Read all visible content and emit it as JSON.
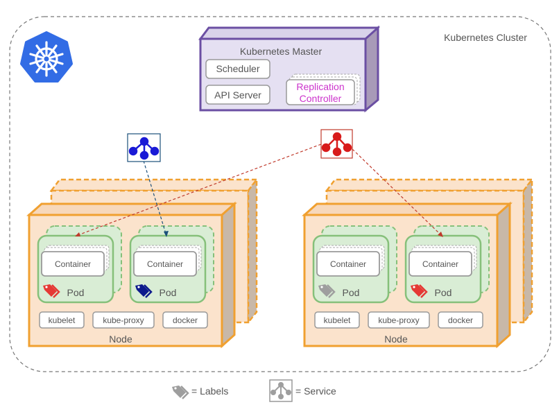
{
  "cluster": {
    "label": "Kubernetes Cluster"
  },
  "master": {
    "title": "Kubernetes Master",
    "components": [
      "Scheduler",
      "API Server"
    ],
    "replication_controller": [
      "Replication",
      "Controller"
    ]
  },
  "nodes": [
    {
      "label": "Node",
      "pods": [
        {
          "label": "Pod",
          "container": "Container",
          "label_color": "#e53935"
        },
        {
          "label": "Pod",
          "container": "Container",
          "label_color": "#0d1a8c"
        }
      ],
      "agents": [
        "kubelet",
        "kube-proxy",
        "docker"
      ]
    },
    {
      "label": "Node",
      "pods": [
        {
          "label": "Pod",
          "container": "Container",
          "label_color": "#9e9e9e"
        },
        {
          "label": "Pod",
          "container": "Container",
          "label_color": "#e53935"
        }
      ],
      "agents": [
        "kubelet",
        "kube-proxy",
        "docker"
      ]
    }
  ],
  "services": [
    {
      "name": "blue-service",
      "color": "#1a1ad6"
    },
    {
      "name": "red-service",
      "color": "#d81b1b"
    }
  ],
  "legend": {
    "labels_text": "= Labels",
    "service_text": "= Service"
  },
  "colors": {
    "master_fill": "#e5e0f2",
    "master_stroke": "#6b4fa3",
    "node_fill": "#fbe3cc",
    "node_stroke": "#f0a030",
    "pod_fill": "#d9edd5",
    "pod_stroke": "#86c07a",
    "rc_text": "#cc33cc",
    "k8s_blue": "#326ce5"
  }
}
